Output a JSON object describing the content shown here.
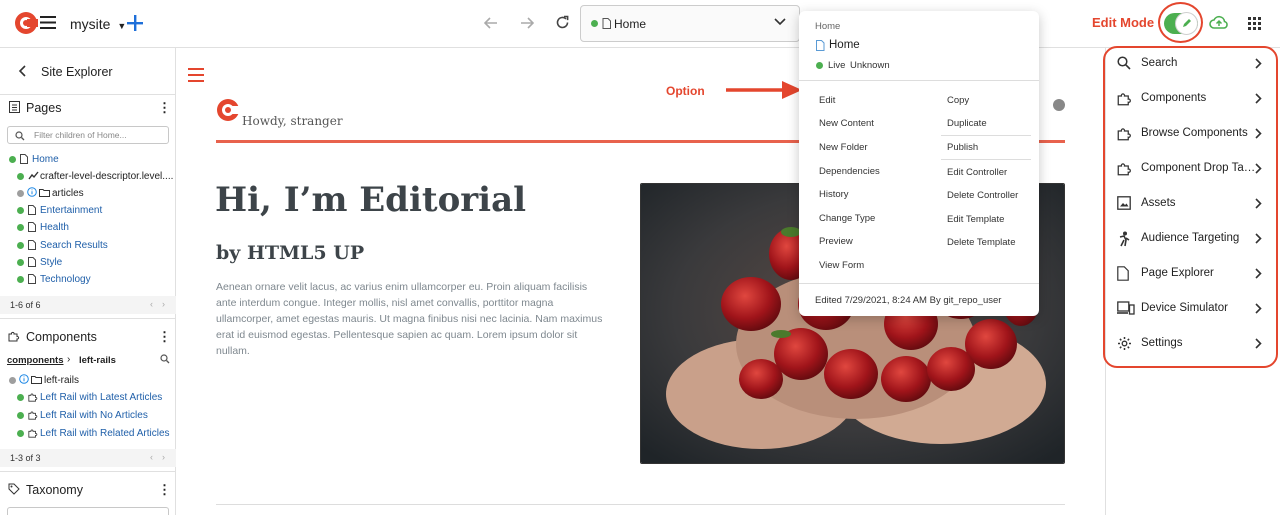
{
  "topbar": {
    "site_name": "mysite",
    "address_page": "Home",
    "edit_mode_label": "Edit Mode"
  },
  "sidebar": {
    "back_title": "Site Explorer",
    "pages": {
      "title": "Pages",
      "filter_placeholder": "Filter children of Home...",
      "items": [
        {
          "label": "Home",
          "status": "live"
        },
        {
          "label": "crafter-level-descriptor.level....",
          "status": "live"
        },
        {
          "label": "articles",
          "status": "unknown"
        },
        {
          "label": "Entertainment",
          "status": "live"
        },
        {
          "label": "Health",
          "status": "live"
        },
        {
          "label": "Search Results",
          "status": "live"
        },
        {
          "label": "Style",
          "status": "live"
        },
        {
          "label": "Technology",
          "status": "live"
        }
      ],
      "pager": "1-6 of 6"
    },
    "components": {
      "title": "Components",
      "breadcrumb_root": "components",
      "breadcrumb_current": "left-rails",
      "items": [
        {
          "label": "left-rails",
          "status": "unknown"
        },
        {
          "label": "Left Rail with Latest Articles",
          "status": "live"
        },
        {
          "label": "Left Rail with No Articles",
          "status": "live"
        },
        {
          "label": "Left Rail with Related Articles",
          "status": "live"
        }
      ],
      "pager": "1-3 of 3"
    },
    "taxonomy": {
      "title": "Taxonomy"
    }
  },
  "preview": {
    "greeting": "Howdy, stranger",
    "hero_title": "Hi, I’m Editorial",
    "hero_subtitle": "by HTML5 UP",
    "hero_body": "Aenean ornare velit lacus, ac varius enim ullamcorper eu. Proin aliquam facilisis ante interdum congue. Integer mollis, nisl amet convallis, porttitor magna ullamcorper, amet egestas mauris. Ut magna finibus nisi nec lacinia. Nam maximus erat id euismod egestas. Pellentesque sapien ac quam. Lorem ipsum dolor sit nullam.",
    "annotation_option": "Option"
  },
  "popover": {
    "breadcrumb": "Home",
    "title": "Home",
    "status_live": "Live",
    "status_unknown": "Unknown",
    "left_menu": [
      "Edit",
      "New Content",
      "New Folder",
      "Dependencies",
      "History",
      "Change Type",
      "Preview",
      "View Form"
    ],
    "right_menu": [
      "Copy",
      "Duplicate",
      "Publish",
      "Edit Controller",
      "Delete Controller",
      "Edit Template",
      "Delete Template"
    ],
    "footer": "Edited 7/29/2021, 8:24 AM By git_repo_user"
  },
  "right_panel": {
    "items": [
      {
        "label": "Search",
        "icon": "search-icon"
      },
      {
        "label": "Components",
        "icon": "puzzle-icon"
      },
      {
        "label": "Browse Components",
        "icon": "puzzle-icon"
      },
      {
        "label": "Component Drop Targets",
        "icon": "puzzle-icon"
      },
      {
        "label": "Assets",
        "icon": "image-icon"
      },
      {
        "label": "Audience Targeting",
        "icon": "person-icon"
      },
      {
        "label": "Page Explorer",
        "icon": "page-icon"
      },
      {
        "label": "Device Simulator",
        "icon": "devices-icon"
      },
      {
        "label": "Settings",
        "icon": "gear-icon"
      }
    ]
  },
  "colors": {
    "brand_red": "#e4462e",
    "live_green": "#4caf50",
    "link_blue": "#1f5fa9"
  }
}
